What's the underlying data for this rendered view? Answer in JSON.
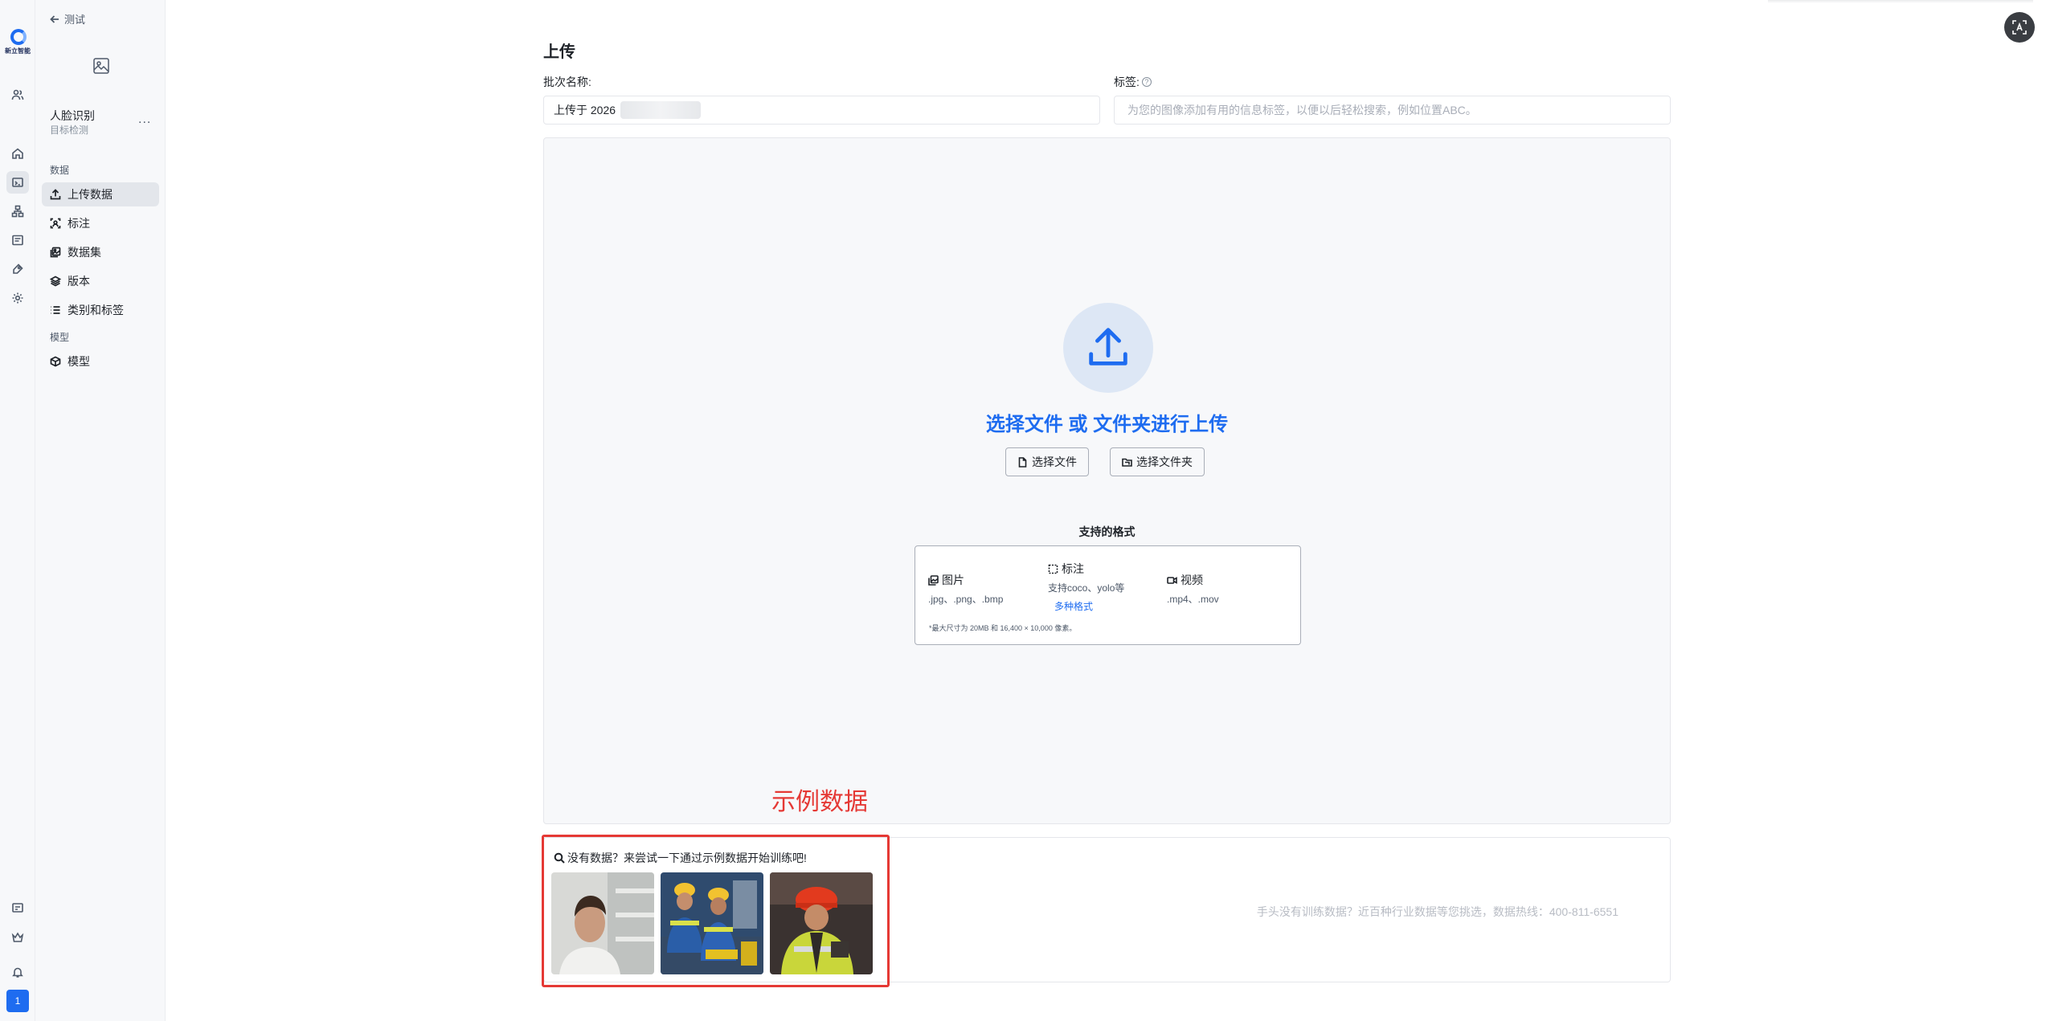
{
  "sidebar": {
    "back_label": "测试",
    "brand_text": "新立智能",
    "project_name": "人脸识别",
    "project_type": "目标检测",
    "more_label": "...",
    "section_data": "数据",
    "section_model": "模型",
    "items": [
      {
        "label": "上传数据",
        "icon": "upload-icon",
        "active": true
      },
      {
        "label": "标注",
        "icon": "annotate-icon",
        "active": false
      },
      {
        "label": "数据集",
        "icon": "dataset-icon",
        "active": false
      },
      {
        "label": "版本",
        "icon": "layers-icon",
        "active": false
      },
      {
        "label": "类别和标签",
        "icon": "list-icon",
        "active": false
      }
    ],
    "model_items": [
      {
        "label": "模型",
        "icon": "cube-icon"
      }
    ],
    "user_badge": "1"
  },
  "main": {
    "title": "上传",
    "batch_label": "批次名称:",
    "batch_value": "上传于 2026",
    "tags_label": "标签:",
    "tags_help": "?",
    "tags_placeholder": "为您的图像添加有用的信息标签，以便以后轻松搜索，例如位置ABC。",
    "drop_title": "选择文件 或 文件夹进行上传",
    "select_file_button": "选择文件",
    "select_folder_button": "选择文件夹",
    "formats_title": "支持的格式",
    "formats": {
      "image_title": "图片",
      "image_ext": ".jpg、.png、.bmp",
      "annotation_title": "标注",
      "annotation_desc": "支持coco、yolo等",
      "annotation_link": "多种格式",
      "video_title": "视频",
      "video_ext": ".mp4、.mov",
      "note": "*最大尺寸为 20MB 和 16,400 × 10,000 像素。"
    },
    "example_label": "示例数据",
    "sample_prompt": "没有数据？来尝试一下通过示例数据开始训练吧!",
    "hotline": "手头没有训练数据？近百种行业数据等您挑选，数据热线：400-811-6551"
  },
  "colors": {
    "accent": "#1e6cf0",
    "highlight_red": "#e53935"
  }
}
